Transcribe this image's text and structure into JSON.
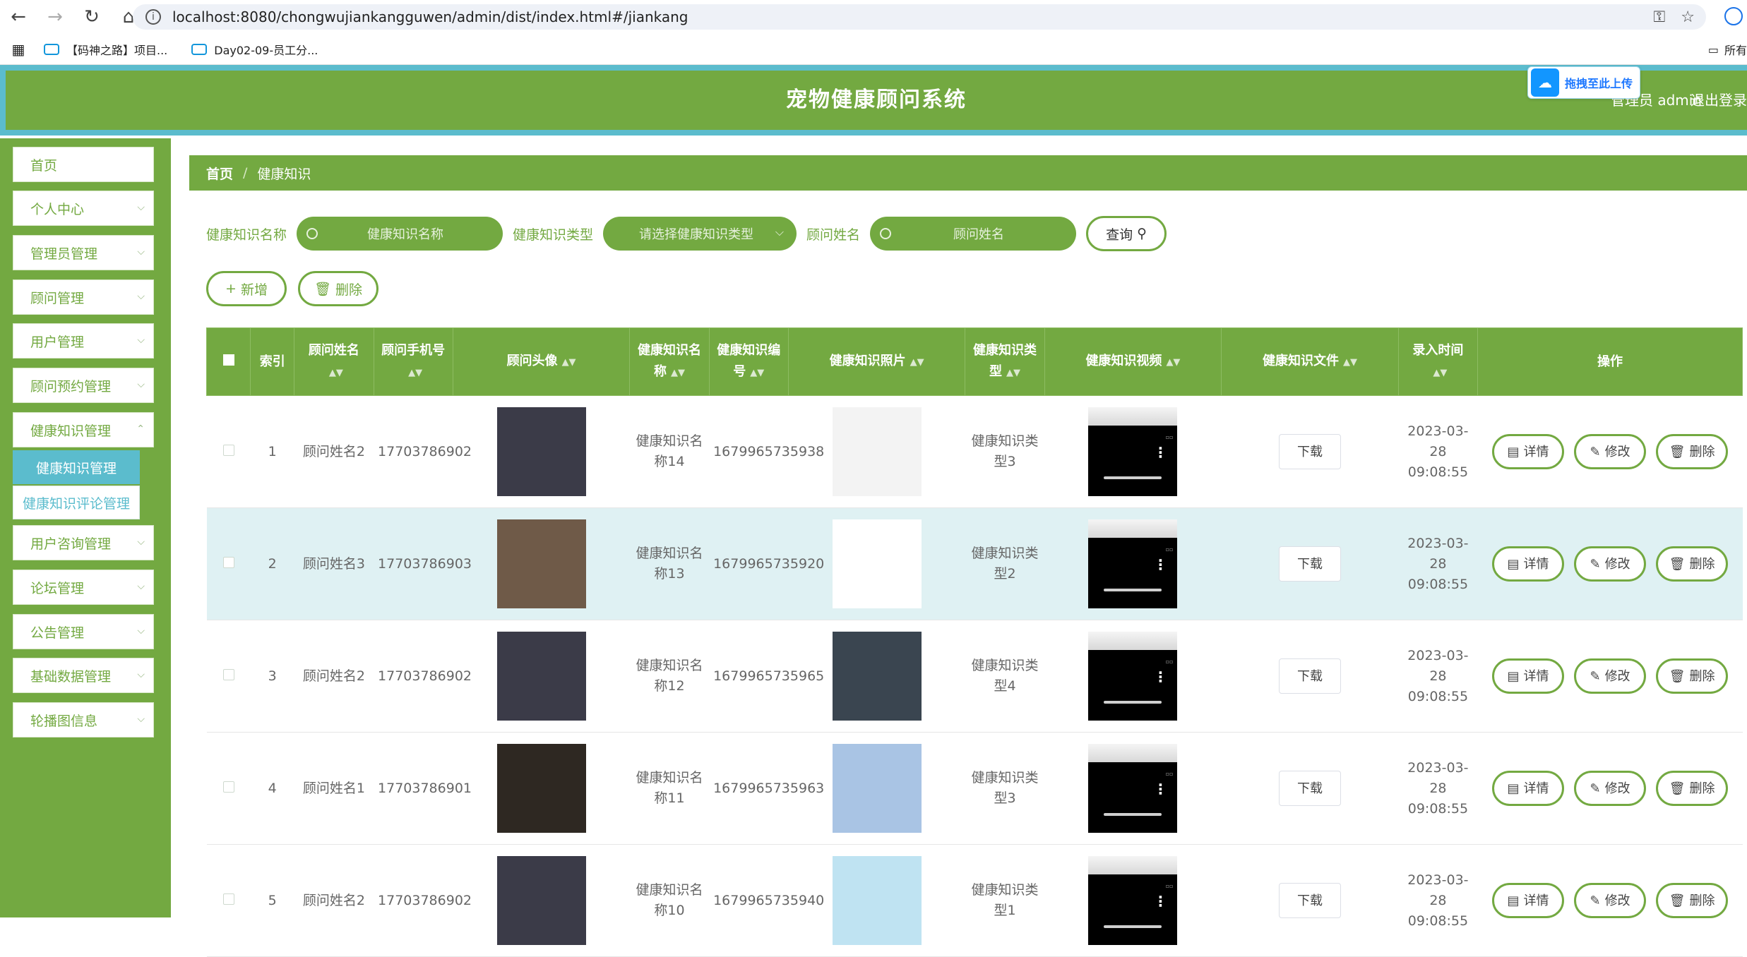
{
  "browser": {
    "url": "localhost:8080/chongwujiankangguwen/admin/dist/index.html#/jiankang",
    "bookmarks": [
      "【码神之路】项目...",
      "Day02-09-员工分..."
    ],
    "bookmarks_right": "所有"
  },
  "header": {
    "title": "宠物健康顾问系统",
    "user": "管理员 admin",
    "logout": "退出登录",
    "upload_badge": "拖拽至此上传"
  },
  "sidebar": {
    "items": [
      "首页",
      "个人中心",
      "管理员管理",
      "顾问管理",
      "用户管理",
      "顾问预约管理",
      "健康知识管理",
      "用户咨询管理",
      "论坛管理",
      "公告管理",
      "基础数据管理",
      "轮播图信息"
    ],
    "submenu": [
      "健康知识管理",
      "健康知识评论管理"
    ]
  },
  "breadcrumb": {
    "home": "首页",
    "sep": "/",
    "current": "健康知识"
  },
  "search": {
    "name_label": "健康知识名称",
    "name_placeholder": "健康知识名称",
    "type_label": "健康知识类型",
    "type_placeholder": "请选择健康知识类型",
    "advisor_label": "顾问姓名",
    "advisor_placeholder": "顾问姓名",
    "query_button": "查询"
  },
  "actions": {
    "add": "新增",
    "delete": "删除"
  },
  "table": {
    "headers": [
      "索引",
      "顾问姓名",
      "顾问手机号",
      "顾问头像",
      "健康知识名称",
      "健康知识编号",
      "健康知识照片",
      "健康知识类型",
      "健康知识视频",
      "健康知识文件",
      "录入时间",
      "操作"
    ],
    "download_label": "下载",
    "op_labels": [
      "详情",
      "修改",
      "删除"
    ],
    "rows": [
      {
        "index": "1",
        "name": "顾问姓名2",
        "phone": "17703786902",
        "kname": "健康知识名称14",
        "code": "1679965735938",
        "type": "健康知识类型3",
        "time": "2023-03-28 09:08:55",
        "avatar_color": "#3b3b48",
        "photo_color": "#f3f3f3"
      },
      {
        "index": "2",
        "name": "顾问姓名3",
        "phone": "17703786903",
        "kname": "健康知识名称13",
        "code": "1679965735920",
        "type": "健康知识类型2",
        "time": "2023-03-28 09:08:55",
        "avatar_color": "#6f5a48",
        "photo_color": "#ffffff"
      },
      {
        "index": "3",
        "name": "顾问姓名2",
        "phone": "17703786902",
        "kname": "健康知识名称12",
        "code": "1679965735965",
        "type": "健康知识类型4",
        "time": "2023-03-28 09:08:55",
        "avatar_color": "#3b3b48",
        "photo_color": "#3a4550"
      },
      {
        "index": "4",
        "name": "顾问姓名1",
        "phone": "17703786901",
        "kname": "健康知识名称11",
        "code": "1679965735963",
        "type": "健康知识类型3",
        "time": "2023-03-28 09:08:55",
        "avatar_color": "#2e2822",
        "photo_color": "#a9c4e4"
      },
      {
        "index": "5",
        "name": "顾问姓名2",
        "phone": "17703786902",
        "kname": "健康知识名称10",
        "code": "1679965735940",
        "type": "健康知识类型1",
        "time": "2023-03-28 09:08:55",
        "avatar_color": "#3b3b48",
        "photo_color": "#bfe3f2"
      }
    ]
  }
}
